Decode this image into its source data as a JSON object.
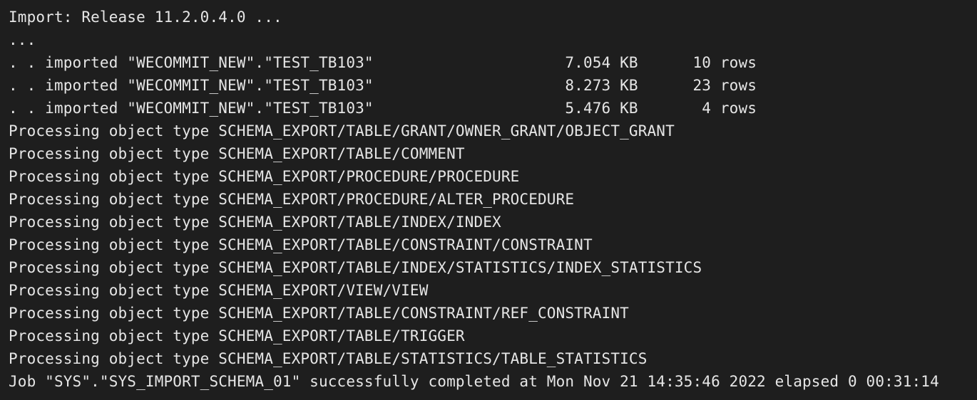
{
  "terminal": {
    "lines": [
      "Import: Release 11.2.0.4.0 ...",
      "...",
      ". . imported \"WECOMMIT_NEW\".\"TEST_TB103\"                     7.054 KB      10 rows",
      ". . imported \"WECOMMIT_NEW\".\"TEST_TB103\"                     8.273 KB      23 rows",
      ". . imported \"WECOMMIT_NEW\".\"TEST_TB103\"                     5.476 KB       4 rows",
      "Processing object type SCHEMA_EXPORT/TABLE/GRANT/OWNER_GRANT/OBJECT_GRANT",
      "Processing object type SCHEMA_EXPORT/TABLE/COMMENT",
      "Processing object type SCHEMA_EXPORT/PROCEDURE/PROCEDURE",
      "Processing object type SCHEMA_EXPORT/PROCEDURE/ALTER_PROCEDURE",
      "Processing object type SCHEMA_EXPORT/TABLE/INDEX/INDEX",
      "Processing object type SCHEMA_EXPORT/TABLE/CONSTRAINT/CONSTRAINT",
      "Processing object type SCHEMA_EXPORT/TABLE/INDEX/STATISTICS/INDEX_STATISTICS",
      "Processing object type SCHEMA_EXPORT/VIEW/VIEW",
      "Processing object type SCHEMA_EXPORT/TABLE/CONSTRAINT/REF_CONSTRAINT",
      "Processing object type SCHEMA_EXPORT/TABLE/TRIGGER",
      "Processing object type SCHEMA_EXPORT/TABLE/STATISTICS/TABLE_STATISTICS",
      "Job \"SYS\".\"SYS_IMPORT_SCHEMA_01\" successfully completed at Mon Nov 21 14:35:46 2022 elapsed 0 00:31:14"
    ]
  },
  "colors": {
    "background": "#1e1e1e",
    "text": "#e6e6e6"
  }
}
